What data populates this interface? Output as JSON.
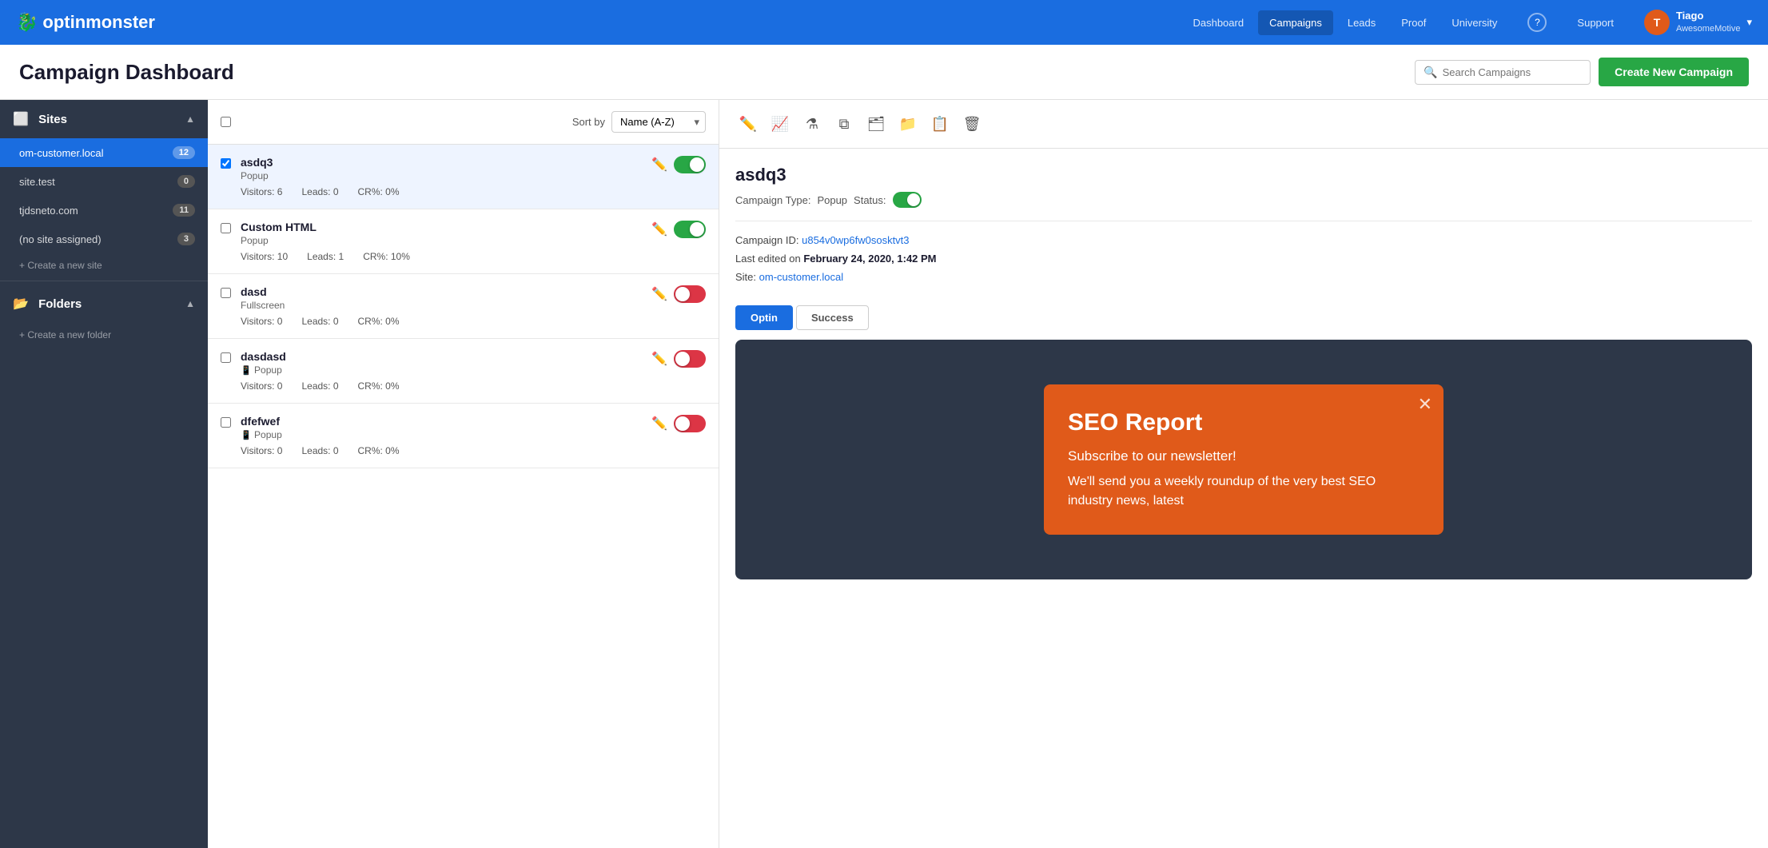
{
  "nav": {
    "logo_text": "optinmonster",
    "links": [
      {
        "label": "Dashboard",
        "active": false
      },
      {
        "label": "Campaigns",
        "active": true
      },
      {
        "label": "Leads",
        "active": false
      },
      {
        "label": "Proof",
        "active": false
      },
      {
        "label": "University",
        "active": false
      }
    ],
    "help_label": "?",
    "support_label": "Support",
    "user": {
      "avatar": "T",
      "name": "Tiago",
      "company": "AwesomeMotive"
    }
  },
  "header": {
    "title": "Campaign Dashboard",
    "search_placeholder": "Search Campaigns",
    "create_btn": "Create New Campaign"
  },
  "sidebar": {
    "sites_label": "Sites",
    "sites_items": [
      {
        "label": "om-customer.local",
        "count": 12,
        "active": true
      },
      {
        "label": "site.test",
        "count": 0,
        "active": false
      },
      {
        "label": "tjdsneto.com",
        "count": 11,
        "active": false
      },
      {
        "label": "(no site assigned)",
        "count": 3,
        "active": false
      }
    ],
    "create_site_label": "+ Create a new site",
    "folders_label": "Folders",
    "create_folder_label": "+ Create a new folder"
  },
  "sort": {
    "label": "Sort by",
    "selected": "Name (A-Z)"
  },
  "campaigns": [
    {
      "name": "asdq3",
      "type": "Popup",
      "type_icon": "",
      "visitors": 6,
      "leads": 0,
      "cr": "0%",
      "enabled": true
    },
    {
      "name": "Custom HTML",
      "type": "Popup",
      "type_icon": "",
      "visitors": 10,
      "leads": 1,
      "cr": "10%",
      "enabled": true
    },
    {
      "name": "dasd",
      "type": "Fullscreen",
      "type_icon": "",
      "visitors": 0,
      "leads": 0,
      "cr": "0%",
      "enabled": false
    },
    {
      "name": "dasdasd",
      "type": "Popup",
      "type_icon": "📱",
      "visitors": 0,
      "leads": 0,
      "cr": "0%",
      "enabled": false
    },
    {
      "name": "dfefwef",
      "type": "Popup",
      "type_icon": "📱",
      "visitors": 0,
      "leads": 0,
      "cr": "0%",
      "enabled": false
    }
  ],
  "detail": {
    "campaign_name": "asdq3",
    "campaign_type_label": "Campaign Type:",
    "campaign_type": "Popup",
    "status_label": "Status:",
    "id_label": "Campaign ID:",
    "campaign_id": "u854v0wp6fw0sosktvt3",
    "edited_label": "Last edited on",
    "edited_date": "February 24, 2020, 1:42 PM",
    "site_label": "Site:",
    "site_name": "om-customer.local",
    "tab_optin": "Optin",
    "tab_success": "Success",
    "preview_title": "SEO Report",
    "preview_subtitle": "Subscribe to our newsletter!",
    "preview_body": "We'll send you a weekly roundup of the very best SEO industry news, latest"
  },
  "toolbar_icons": [
    {
      "name": "edit-icon",
      "glyph": "✏️"
    },
    {
      "name": "analytics-icon",
      "glyph": "📈"
    },
    {
      "name": "filter-icon",
      "glyph": "⚗️"
    },
    {
      "name": "copy-icon",
      "glyph": "⧉"
    },
    {
      "name": "archive-icon",
      "glyph": "🗂"
    },
    {
      "name": "move-icon",
      "glyph": "📁"
    },
    {
      "name": "export-icon",
      "glyph": "📋"
    },
    {
      "name": "delete-icon",
      "glyph": "🗑"
    }
  ]
}
